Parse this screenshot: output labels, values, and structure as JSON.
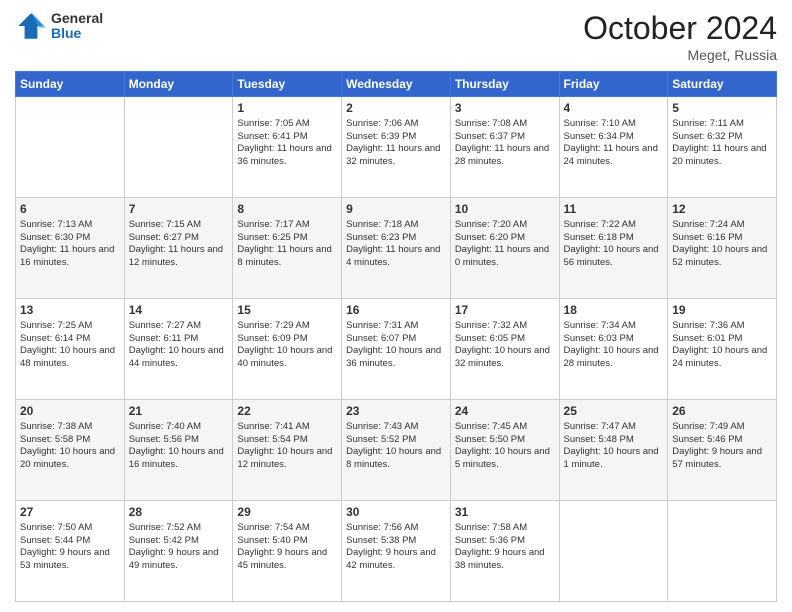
{
  "header": {
    "logo_general": "General",
    "logo_blue": "Blue",
    "month": "October 2024",
    "location": "Meget, Russia"
  },
  "days_of_week": [
    "Sunday",
    "Monday",
    "Tuesday",
    "Wednesday",
    "Thursday",
    "Friday",
    "Saturday"
  ],
  "weeks": [
    [
      {
        "day": "",
        "info": ""
      },
      {
        "day": "",
        "info": ""
      },
      {
        "day": "1",
        "info": "Sunrise: 7:05 AM\nSunset: 6:41 PM\nDaylight: 11 hours and 36 minutes."
      },
      {
        "day": "2",
        "info": "Sunrise: 7:06 AM\nSunset: 6:39 PM\nDaylight: 11 hours and 32 minutes."
      },
      {
        "day": "3",
        "info": "Sunrise: 7:08 AM\nSunset: 6:37 PM\nDaylight: 11 hours and 28 minutes."
      },
      {
        "day": "4",
        "info": "Sunrise: 7:10 AM\nSunset: 6:34 PM\nDaylight: 11 hours and 24 minutes."
      },
      {
        "day": "5",
        "info": "Sunrise: 7:11 AM\nSunset: 6:32 PM\nDaylight: 11 hours and 20 minutes."
      }
    ],
    [
      {
        "day": "6",
        "info": "Sunrise: 7:13 AM\nSunset: 6:30 PM\nDaylight: 11 hours and 16 minutes."
      },
      {
        "day": "7",
        "info": "Sunrise: 7:15 AM\nSunset: 6:27 PM\nDaylight: 11 hours and 12 minutes."
      },
      {
        "day": "8",
        "info": "Sunrise: 7:17 AM\nSunset: 6:25 PM\nDaylight: 11 hours and 8 minutes."
      },
      {
        "day": "9",
        "info": "Sunrise: 7:18 AM\nSunset: 6:23 PM\nDaylight: 11 hours and 4 minutes."
      },
      {
        "day": "10",
        "info": "Sunrise: 7:20 AM\nSunset: 6:20 PM\nDaylight: 11 hours and 0 minutes."
      },
      {
        "day": "11",
        "info": "Sunrise: 7:22 AM\nSunset: 6:18 PM\nDaylight: 10 hours and 56 minutes."
      },
      {
        "day": "12",
        "info": "Sunrise: 7:24 AM\nSunset: 6:16 PM\nDaylight: 10 hours and 52 minutes."
      }
    ],
    [
      {
        "day": "13",
        "info": "Sunrise: 7:25 AM\nSunset: 6:14 PM\nDaylight: 10 hours and 48 minutes."
      },
      {
        "day": "14",
        "info": "Sunrise: 7:27 AM\nSunset: 6:11 PM\nDaylight: 10 hours and 44 minutes."
      },
      {
        "day": "15",
        "info": "Sunrise: 7:29 AM\nSunset: 6:09 PM\nDaylight: 10 hours and 40 minutes."
      },
      {
        "day": "16",
        "info": "Sunrise: 7:31 AM\nSunset: 6:07 PM\nDaylight: 10 hours and 36 minutes."
      },
      {
        "day": "17",
        "info": "Sunrise: 7:32 AM\nSunset: 6:05 PM\nDaylight: 10 hours and 32 minutes."
      },
      {
        "day": "18",
        "info": "Sunrise: 7:34 AM\nSunset: 6:03 PM\nDaylight: 10 hours and 28 minutes."
      },
      {
        "day": "19",
        "info": "Sunrise: 7:36 AM\nSunset: 6:01 PM\nDaylight: 10 hours and 24 minutes."
      }
    ],
    [
      {
        "day": "20",
        "info": "Sunrise: 7:38 AM\nSunset: 5:58 PM\nDaylight: 10 hours and 20 minutes."
      },
      {
        "day": "21",
        "info": "Sunrise: 7:40 AM\nSunset: 5:56 PM\nDaylight: 10 hours and 16 minutes."
      },
      {
        "day": "22",
        "info": "Sunrise: 7:41 AM\nSunset: 5:54 PM\nDaylight: 10 hours and 12 minutes."
      },
      {
        "day": "23",
        "info": "Sunrise: 7:43 AM\nSunset: 5:52 PM\nDaylight: 10 hours and 8 minutes."
      },
      {
        "day": "24",
        "info": "Sunrise: 7:45 AM\nSunset: 5:50 PM\nDaylight: 10 hours and 5 minutes."
      },
      {
        "day": "25",
        "info": "Sunrise: 7:47 AM\nSunset: 5:48 PM\nDaylight: 10 hours and 1 minute."
      },
      {
        "day": "26",
        "info": "Sunrise: 7:49 AM\nSunset: 5:46 PM\nDaylight: 9 hours and 57 minutes."
      }
    ],
    [
      {
        "day": "27",
        "info": "Sunrise: 7:50 AM\nSunset: 5:44 PM\nDaylight: 9 hours and 53 minutes."
      },
      {
        "day": "28",
        "info": "Sunrise: 7:52 AM\nSunset: 5:42 PM\nDaylight: 9 hours and 49 minutes."
      },
      {
        "day": "29",
        "info": "Sunrise: 7:54 AM\nSunset: 5:40 PM\nDaylight: 9 hours and 45 minutes."
      },
      {
        "day": "30",
        "info": "Sunrise: 7:56 AM\nSunset: 5:38 PM\nDaylight: 9 hours and 42 minutes."
      },
      {
        "day": "31",
        "info": "Sunrise: 7:58 AM\nSunset: 5:36 PM\nDaylight: 9 hours and 38 minutes."
      },
      {
        "day": "",
        "info": ""
      },
      {
        "day": "",
        "info": ""
      }
    ]
  ]
}
